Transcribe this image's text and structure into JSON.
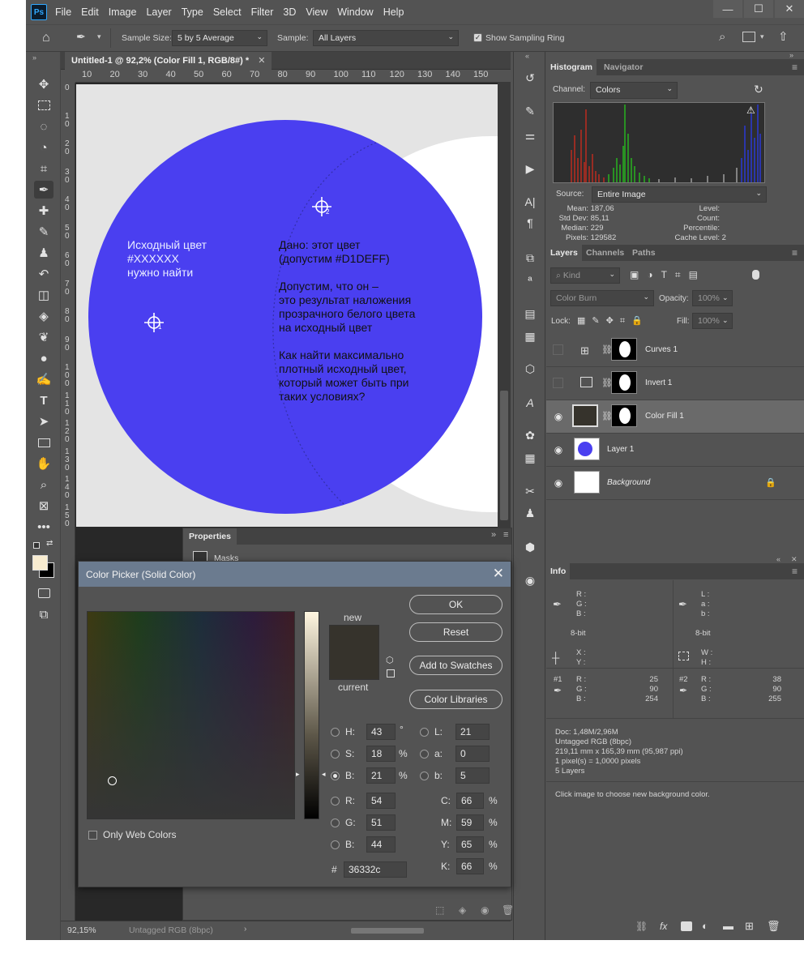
{
  "app": {
    "logo": "Ps"
  },
  "menu": [
    "File",
    "Edit",
    "Image",
    "Layer",
    "Type",
    "Select",
    "Filter",
    "3D",
    "View",
    "Window",
    "Help"
  ],
  "window_buttons": [
    "—",
    "☐",
    "✕"
  ],
  "options": {
    "sample_size_label": "Sample Size:",
    "sample_size_value": "5 by 5 Average",
    "sample_label": "Sample:",
    "sample_value": "All Layers",
    "show_ring_label": "Show Sampling Ring"
  },
  "document": {
    "tab_title": "Untitled-1 @ 92,2% (Color Fill 1, RGB/8#) *",
    "ruler_h": [
      "10",
      "20",
      "30",
      "40",
      "50",
      "60",
      "70",
      "80",
      "90",
      "100",
      "110",
      "120",
      "130",
      "140",
      "150"
    ],
    "ruler_v": [
      "0",
      "1 0",
      "2 0",
      "3 0",
      "4 0",
      "5 0",
      "6 0",
      "7 0",
      "8 0",
      "9 0",
      "1 0 0",
      "1 1 0",
      "1 2 0",
      "1 3 0",
      "1 4 0",
      "1 5 0"
    ],
    "canvas_text_left": [
      "Исходный цвет",
      "#XXXXXX",
      "нужно найти"
    ],
    "canvas_text_right": [
      "Дано: этот цвет",
      "(допустим #D1DEFF)",
      "",
      "Допустим, что он –",
      "это результат наложения",
      "прозрачного белого цвета",
      "на исходный цвет",
      "",
      "Как найти максимально",
      "плотный исходный цвет,",
      "который может быть при",
      "таких условиях?"
    ],
    "sampler_1": "1",
    "sampler_2": "2",
    "circle_color": "#4a3ff0"
  },
  "status": {
    "zoom": "92,15%",
    "info": "Untagged RGB (8bpc)"
  },
  "histogram": {
    "tabs": [
      "Histogram",
      "Navigator"
    ],
    "channel_label": "Channel:",
    "channel_value": "Colors",
    "source_label": "Source:",
    "source_value": "Entire Image",
    "stats_left": [
      [
        "Mean:",
        "187,06"
      ],
      [
        "Std Dev:",
        "85,11"
      ],
      [
        "Median:",
        "229"
      ],
      [
        "Pixels:",
        "129582"
      ]
    ],
    "stats_right": [
      [
        "Level:",
        ""
      ],
      [
        "Count:",
        ""
      ],
      [
        "Percentile:",
        ""
      ],
      [
        "Cache Level:",
        "2"
      ]
    ]
  },
  "layers": {
    "tabs": [
      "Layers",
      "Channels",
      "Paths"
    ],
    "kind_placeholder": "Kind",
    "blend_mode": "Color Burn",
    "opacity_label": "Opacity:",
    "opacity_value": "100%",
    "lock_label": "Lock:",
    "fill_label": "Fill:",
    "fill_value": "100%",
    "items": [
      {
        "name": "Curves 1",
        "visible": false
      },
      {
        "name": "Invert 1",
        "visible": false
      },
      {
        "name": "Color Fill 1",
        "visible": true
      },
      {
        "name": "Layer 1",
        "visible": true
      },
      {
        "name": "Background",
        "visible": true
      }
    ]
  },
  "info": {
    "title": "Info",
    "rgb_labels": [
      "R :",
      "G :",
      "B :"
    ],
    "lab_labels": [
      "L :",
      "a :",
      "b :"
    ],
    "bit_left": "8-bit",
    "bit_right": "8-bit",
    "xy_labels": [
      "X :",
      "Y :"
    ],
    "wh_labels": [
      "W :",
      "H :"
    ],
    "s1_label": "#1",
    "s1_values": [
      "25",
      "90",
      "254"
    ],
    "s2_label": "#2",
    "s2_values": [
      "38",
      "90",
      "255"
    ],
    "sampler_rgb": [
      "R :",
      "G :",
      "B :"
    ],
    "doc_lines": [
      "Doc: 1,48M/2,96M",
      "Untagged RGB (8bpc)",
      "219,11 mm x 165,39 mm (95,987 ppi)",
      "1 pixel(s) = 1,0000 pixels",
      "5 Layers"
    ],
    "hint": "Click image to choose new background color."
  },
  "properties": {
    "title": "Properties",
    "section": "Masks"
  },
  "color_picker": {
    "title": "Color Picker (Solid Color)",
    "new_label": "new",
    "current_label": "current",
    "ok": "OK",
    "reset": "Reset",
    "add_swatches": "Add to Swatches",
    "color_libraries": "Color Libraries",
    "only_web": "Only Web Colors",
    "h_label": "H:",
    "h": "43",
    "h_unit": "°",
    "s_label": "S:",
    "s": "18",
    "s_unit": "%",
    "b_label": "B:",
    "b": "21",
    "b_unit": "%",
    "r_label": "R:",
    "r": "54",
    "g_label": "G:",
    "g": "51",
    "bb_label": "B:",
    "bb": "44",
    "l_label": "L:",
    "l": "21",
    "a_label": "a:",
    "a": "0",
    "lb_label": "b:",
    "lb": "5",
    "c_label": "C:",
    "c": "66",
    "c_unit": "%",
    "m_label": "M:",
    "m": "59",
    "m_unit": "%",
    "y_label": "Y:",
    "y": "65",
    "y_unit": "%",
    "k_label": "K:",
    "k": "66",
    "k_unit": "%",
    "hex_label": "#",
    "hex": "36332c",
    "new_color": "#36332c",
    "current_color": "#36332c"
  }
}
